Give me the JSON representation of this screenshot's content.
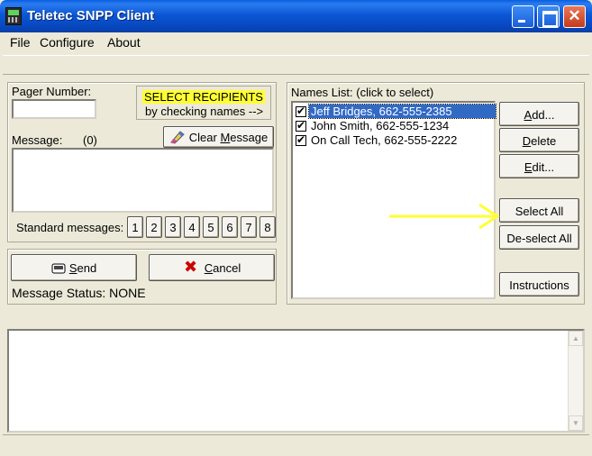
{
  "window": {
    "title": "Teletec SNPP Client",
    "icon": "pager-icon"
  },
  "menu": [
    "File",
    "Configure",
    "About"
  ],
  "left": {
    "pager_label": "Pager Number:",
    "pager_value": "",
    "select_hint_line1": "SELECT RECIPIENTS",
    "select_hint_line2": "by checking names -->",
    "message_label": "Message:",
    "message_count": "(0)",
    "clear_label_pre": "Clear ",
    "clear_label_u": "M",
    "clear_label_post": "essage",
    "message_value": "",
    "standard_label": "Standard messages:",
    "standard_buttons": [
      "1",
      "2",
      "3",
      "4",
      "5",
      "6",
      "7",
      "8"
    ],
    "send_label_u": "S",
    "send_label_post": "end",
    "cancel_label_u": "C",
    "cancel_label_post": "ancel",
    "status_text": "Message Status: NONE"
  },
  "right": {
    "names_label": "Names List:  (click to select)",
    "names": [
      {
        "text": "Jeff Bridges, 662-555-2385",
        "checked": true,
        "selected": true
      },
      {
        "text": "John Smith, 662-555-1234",
        "checked": true,
        "selected": false
      },
      {
        "text": "On Call Tech, 662-555-2222",
        "checked": true,
        "selected": false
      }
    ],
    "buttons": {
      "add_u": "A",
      "add_post": "dd...",
      "delete_u": "D",
      "delete_post": "elete",
      "edit_u": "E",
      "edit_post": "dit...",
      "select_all": "Select All",
      "deselect_all": "De-select All",
      "instructions": "Instructions"
    }
  },
  "colors": {
    "annotation_arrow": "#ffff33",
    "highlight": "#ffff33",
    "selection": "#316ac5"
  }
}
